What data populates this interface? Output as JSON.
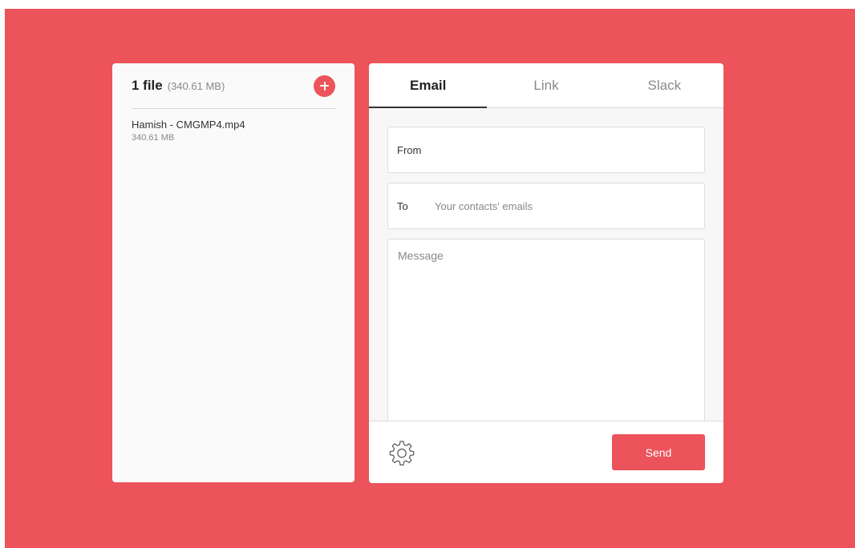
{
  "colors": {
    "accent": "#ec535b",
    "panel_bg": "#fafafa",
    "form_bg": "#f7f7f7"
  },
  "files": {
    "count_label": "1 file",
    "total_size": "(340.61 MB)",
    "add_icon": "plus-icon",
    "items": [
      {
        "name": "Hamish - CMGMP4.mp4",
        "size": "340.61 MB"
      }
    ]
  },
  "tabs": [
    {
      "label": "Email",
      "active": true
    },
    {
      "label": "Link",
      "active": false
    },
    {
      "label": "Slack",
      "active": false
    }
  ],
  "form": {
    "from_label": "From",
    "from_value": "",
    "to_label": "To",
    "to_placeholder": "Your contacts' emails",
    "message_placeholder": "Message"
  },
  "footer": {
    "settings_icon": "gear-icon",
    "send_label": "Send"
  }
}
